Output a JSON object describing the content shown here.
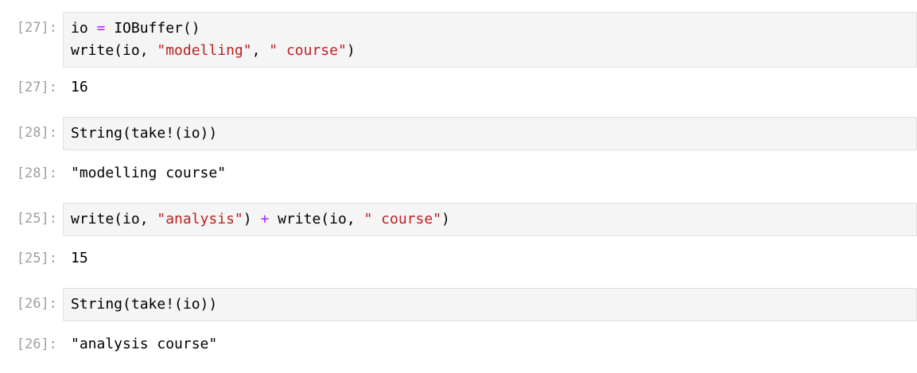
{
  "cells": [
    {
      "in_prompt": "[27]:",
      "code_lines": [
        [
          {
            "t": "io ",
            "k": "plain"
          },
          {
            "t": "=",
            "k": "op"
          },
          {
            "t": " IOBuffer()",
            "k": "plain"
          }
        ],
        [
          {
            "t": "write(io, ",
            "k": "plain"
          },
          {
            "t": "\"modelling\"",
            "k": "str"
          },
          {
            "t": ", ",
            "k": "plain"
          },
          {
            "t": "\" course\"",
            "k": "str"
          },
          {
            "t": ")",
            "k": "plain"
          }
        ]
      ],
      "out_prompt": "[27]:",
      "output": "16"
    },
    {
      "in_prompt": "[28]:",
      "code_lines": [
        [
          {
            "t": "String(take!(io))",
            "k": "plain"
          }
        ]
      ],
      "out_prompt": "[28]:",
      "output": "\"modelling course\""
    },
    {
      "in_prompt": "[25]:",
      "code_lines": [
        [
          {
            "t": "write(io, ",
            "k": "plain"
          },
          {
            "t": "\"analysis\"",
            "k": "str"
          },
          {
            "t": ") ",
            "k": "plain"
          },
          {
            "t": "+",
            "k": "op"
          },
          {
            "t": " write(io, ",
            "k": "plain"
          },
          {
            "t": "\" course\"",
            "k": "str"
          },
          {
            "t": ")",
            "k": "plain"
          }
        ]
      ],
      "out_prompt": "[25]:",
      "output": "15"
    },
    {
      "in_prompt": "[26]:",
      "code_lines": [
        [
          {
            "t": "String(take!(io))",
            "k": "plain"
          }
        ]
      ],
      "out_prompt": "[26]:",
      "output": "\"analysis course\""
    }
  ],
  "colors": {
    "string": "#ba2121",
    "operator": "#aa22ff",
    "prompt": "#9e9e9e",
    "code_background": "#f5f5f5",
    "code_border": "#e0e0e0"
  }
}
